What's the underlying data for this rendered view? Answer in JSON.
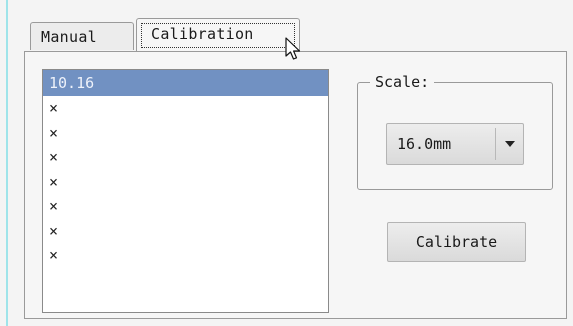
{
  "tabs": [
    {
      "label": "Manual",
      "selected": false
    },
    {
      "label": "Calibration",
      "selected": true
    }
  ],
  "list": {
    "items": [
      "10.16",
      "×",
      "×",
      "×",
      "×",
      "×",
      "×",
      "×"
    ],
    "selected_index": 0
  },
  "scale": {
    "label": "Scale:",
    "value": "16.0mm"
  },
  "calibrate_button": "Calibrate",
  "colors": {
    "selection": "#7191c2",
    "accent_left": "#9fe4ea"
  },
  "icons": {
    "dropdown": "triangle-down-icon",
    "cursor": "mouse-pointer-icon"
  }
}
